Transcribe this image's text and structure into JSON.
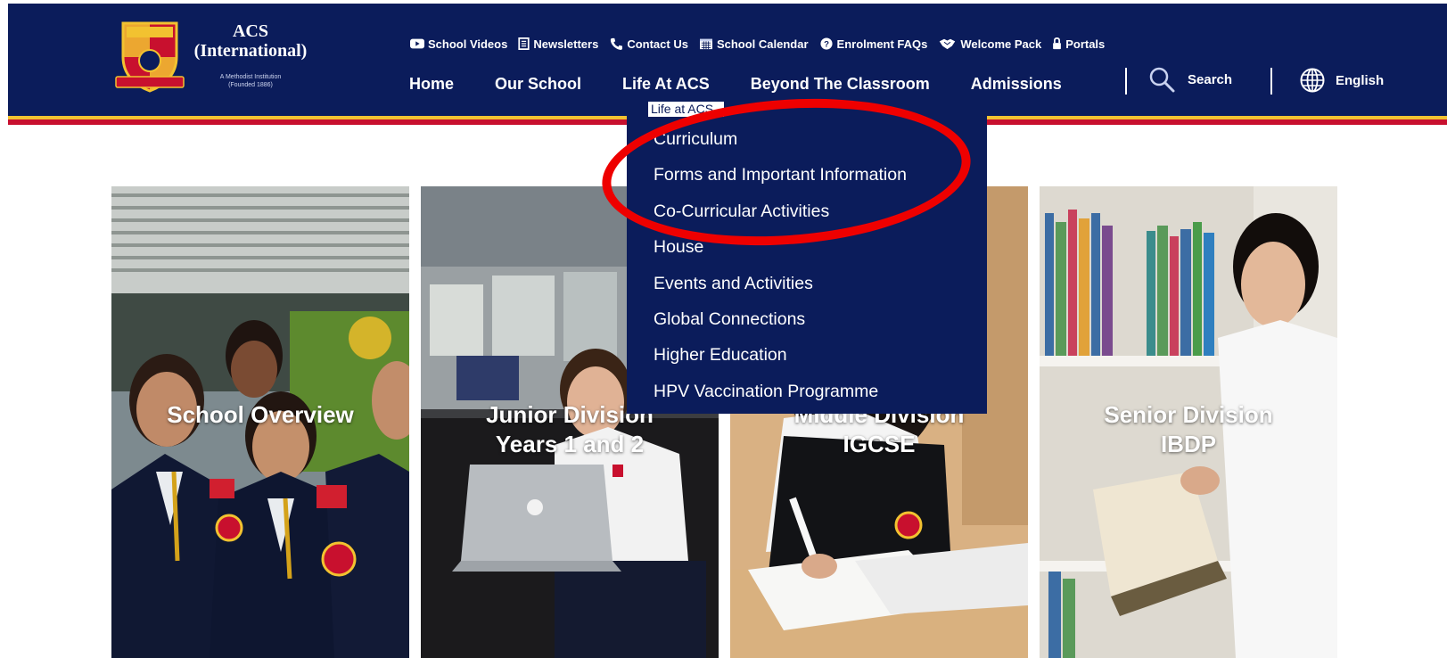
{
  "brand": {
    "name_line1": "ACS",
    "name_line2": "(International)",
    "subtitle_line1": "A Methodist Institution",
    "subtitle_line2": "(Founded 1886)",
    "crest_motto": "THE BEST IS YET TO BE",
    "crest_letters": "AS",
    "color_navy": "#0b1c5b",
    "color_gold": "#f2c230",
    "color_red": "#c8102e"
  },
  "utility_links": [
    {
      "label": "School Videos",
      "icon": "play-icon"
    },
    {
      "label": "Newsletters",
      "icon": "newsletter-icon"
    },
    {
      "label": "Contact Us",
      "icon": "phone-icon"
    },
    {
      "label": "School Calendar",
      "icon": "calendar-icon"
    },
    {
      "label": "Enrolment FAQs",
      "icon": "question-icon"
    },
    {
      "label": "Welcome Pack",
      "icon": "handshake-icon"
    },
    {
      "label": "Portals",
      "icon": "lock-icon"
    }
  ],
  "main_nav": [
    {
      "label": "Home"
    },
    {
      "label": "Our School"
    },
    {
      "label": "Life At ACS"
    },
    {
      "label": "Beyond The Classroom"
    },
    {
      "label": "Admissions"
    }
  ],
  "search": {
    "label": "Search",
    "icon": "search-icon"
  },
  "language": {
    "label": "English",
    "icon": "globe-icon"
  },
  "dropdown": {
    "crumb": "Life at ACS",
    "items": [
      {
        "label": "Curriculum"
      },
      {
        "label": "Forms and Important Information"
      },
      {
        "label": "Co-Curricular Activities"
      },
      {
        "label": "House"
      },
      {
        "label": "Events and Activities"
      },
      {
        "label": "Global Connections"
      },
      {
        "label": "Higher Education"
      },
      {
        "label": "HPV Vaccination Programme"
      }
    ],
    "highlight_color": "#ee0000"
  },
  "tiles": [
    {
      "line1": "School Overview",
      "line2": ""
    },
    {
      "line1": "Junior Division",
      "line2": "Years 1 and 2"
    },
    {
      "line1": "Middle Division",
      "line2": "IGCSE"
    },
    {
      "line1": "Senior Division",
      "line2": "IBDP"
    }
  ]
}
